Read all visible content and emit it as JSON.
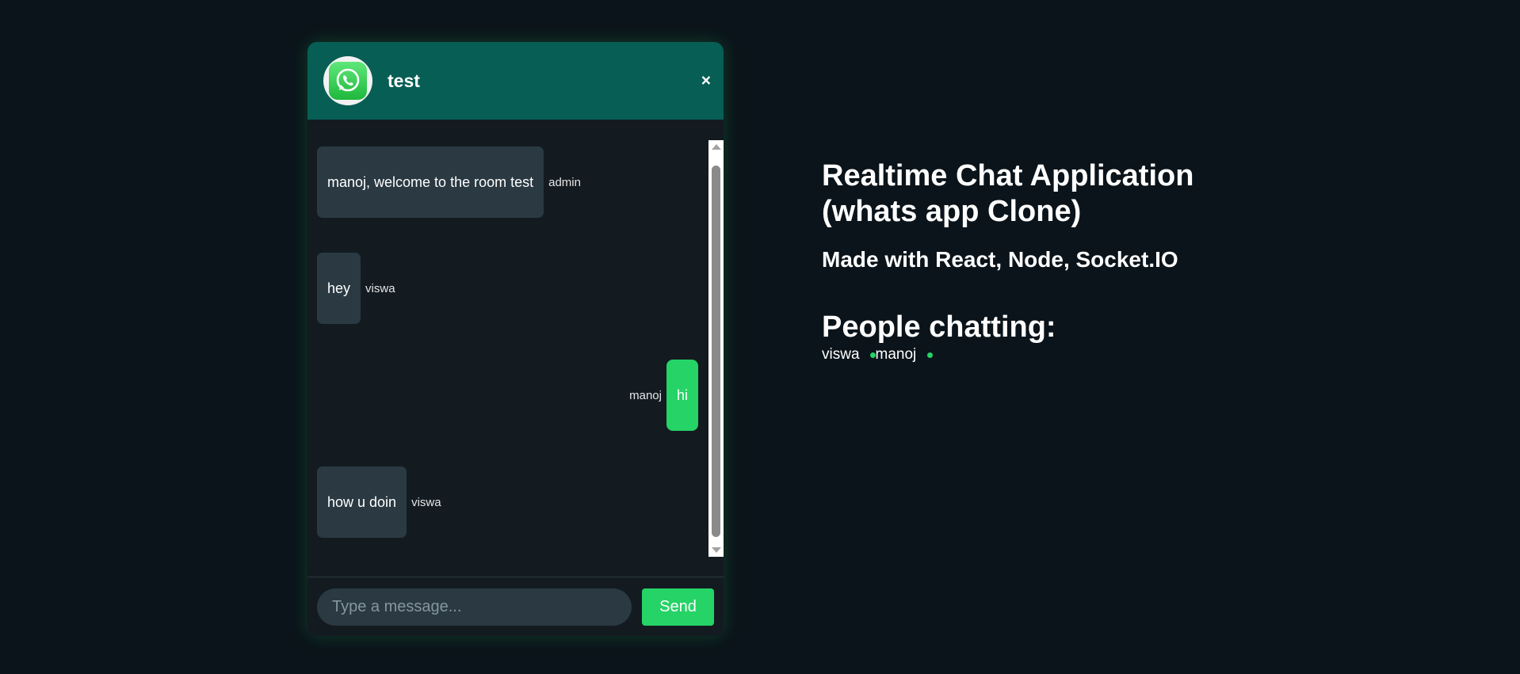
{
  "chat": {
    "room_name": "test",
    "close_label": "×",
    "input": {
      "value": "",
      "placeholder": "Type a message..."
    },
    "send_label": "Send",
    "messages": [
      {
        "text": "manoj, welcome to the room test",
        "sender": "admin",
        "own": false
      },
      {
        "text": "hey",
        "sender": "viswa",
        "own": false
      },
      {
        "text": "hi",
        "sender": "manoj",
        "own": true
      },
      {
        "text": "how u doin",
        "sender": "viswa",
        "own": false
      }
    ]
  },
  "info": {
    "title": "Realtime Chat Application (whats app Clone)",
    "subtitle": "Made with React, Node, Socket.IO",
    "people_heading": "People chatting:",
    "people": [
      "viswa",
      "manoj"
    ]
  },
  "colors": {
    "background": "#0b141a",
    "header": "#075e54",
    "accent": "#25d366",
    "bubble": "#2a3942"
  },
  "icons": {
    "avatar": "whatsapp-logo-icon",
    "close": "close-icon",
    "online": "online-dot-icon"
  }
}
